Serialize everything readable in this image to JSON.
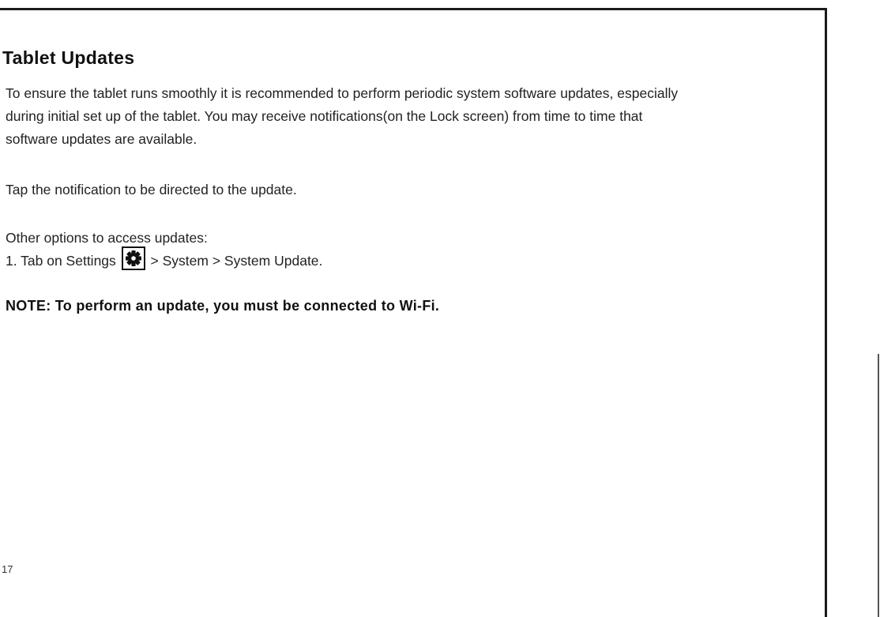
{
  "title": "Tablet Updates",
  "paragraph1": {
    "line1": "To ensure the tablet runs smoothly it is recommended to perform periodic system software updates, especially",
    "line2": "during initial set up of the tablet. You may receive notifications(on the Lock screen) from time to time that",
    "line3": "software updates are available."
  },
  "paragraph2": "Tap the notification to be directed to the update.",
  "paragraph3": {
    "intro": "Other options to access updates:",
    "step1_prefix": "1. Tab on Settings",
    "step1_suffix": "> System >  System Update.",
    "icon": "gear-icon"
  },
  "note": "NOTE: To perform an update, you must be connected to Wi-Fi.",
  "page_number": "17"
}
